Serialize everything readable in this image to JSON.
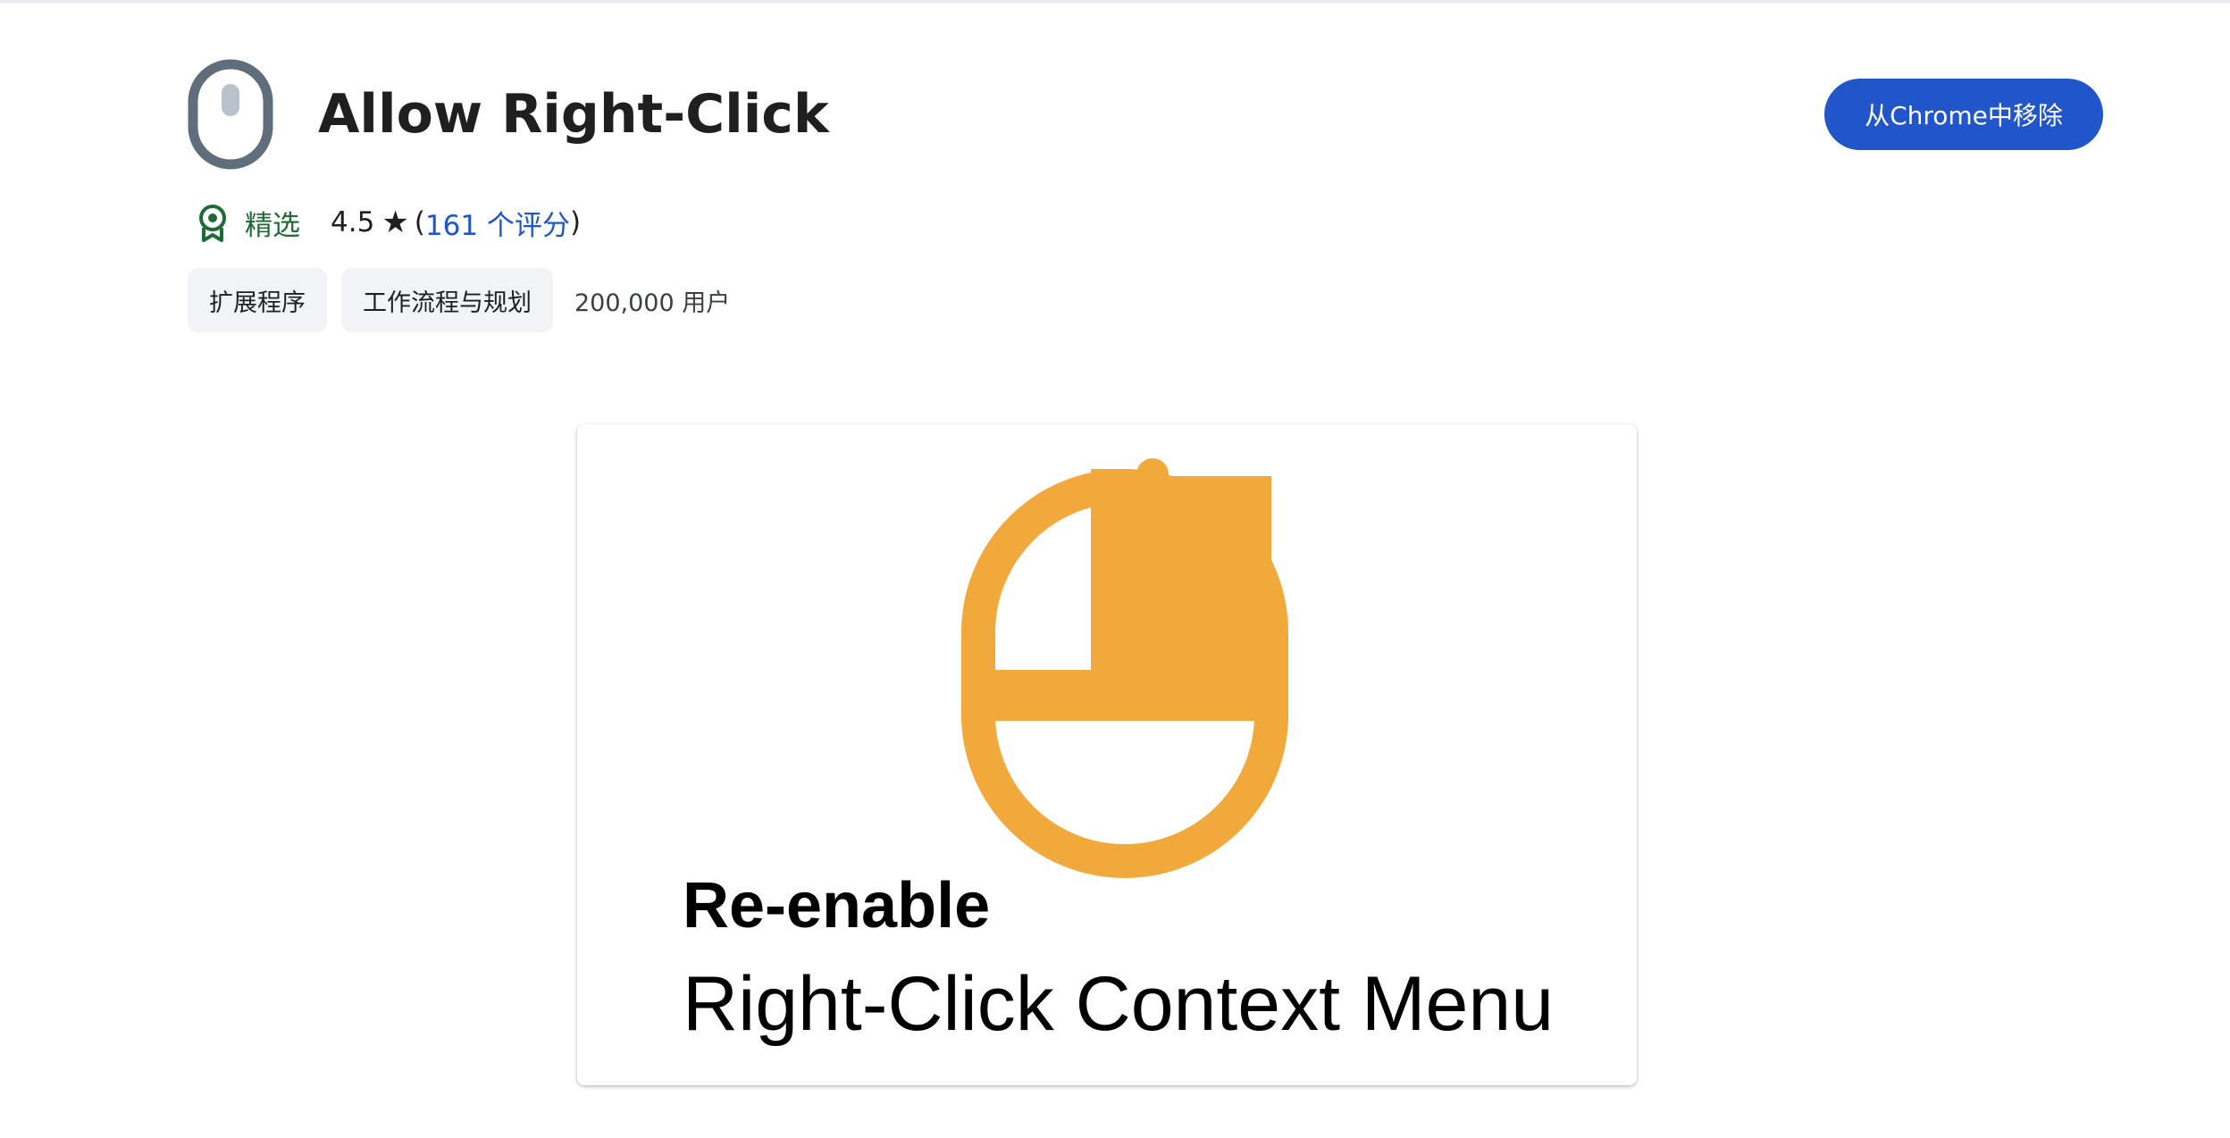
{
  "extension": {
    "title": "Allow Right-Click",
    "icon": "mouse-icon",
    "remove_button_label": "从Chrome中移除"
  },
  "meta": {
    "featured_icon": "featured-badge-icon",
    "featured_label": "精选",
    "rating_value": "4.5",
    "star_glyph": "★",
    "rating_open": "(",
    "rating_count_link": "161 个评分",
    "rating_close": ")"
  },
  "chips": [
    "扩展程序",
    "工作流程与规划"
  ],
  "users": "200,000 用户",
  "screenshot": {
    "line1": "Re-enable",
    "line2": "Right-Click Context Menu",
    "mouse_color": "#F2A93B"
  },
  "colors": {
    "accent": "#2056C9",
    "featured": "#1E6B33",
    "icon_gray": "#5F6E7A"
  }
}
